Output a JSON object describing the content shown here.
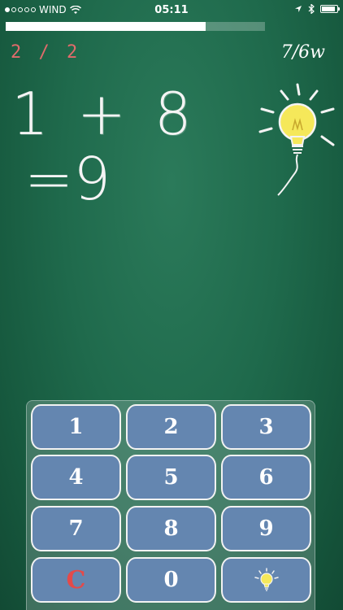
{
  "status_bar": {
    "carrier": "WIND",
    "time": "05:11"
  },
  "progress": {
    "fraction": 0.77
  },
  "counter": "2 / 2",
  "score": "7/6w",
  "question": {
    "expression": "1 + 8",
    "answer": "=9"
  },
  "keypad": {
    "keys": [
      "1",
      "2",
      "3",
      "4",
      "5",
      "6",
      "7",
      "8",
      "9",
      "C",
      "0"
    ]
  },
  "colors": {
    "board": "#1f6a4c",
    "key_fill": "#6486b0",
    "counter": "#e06b6b",
    "clear_key": "#e34a4a",
    "bulb": "#f5e85a"
  }
}
